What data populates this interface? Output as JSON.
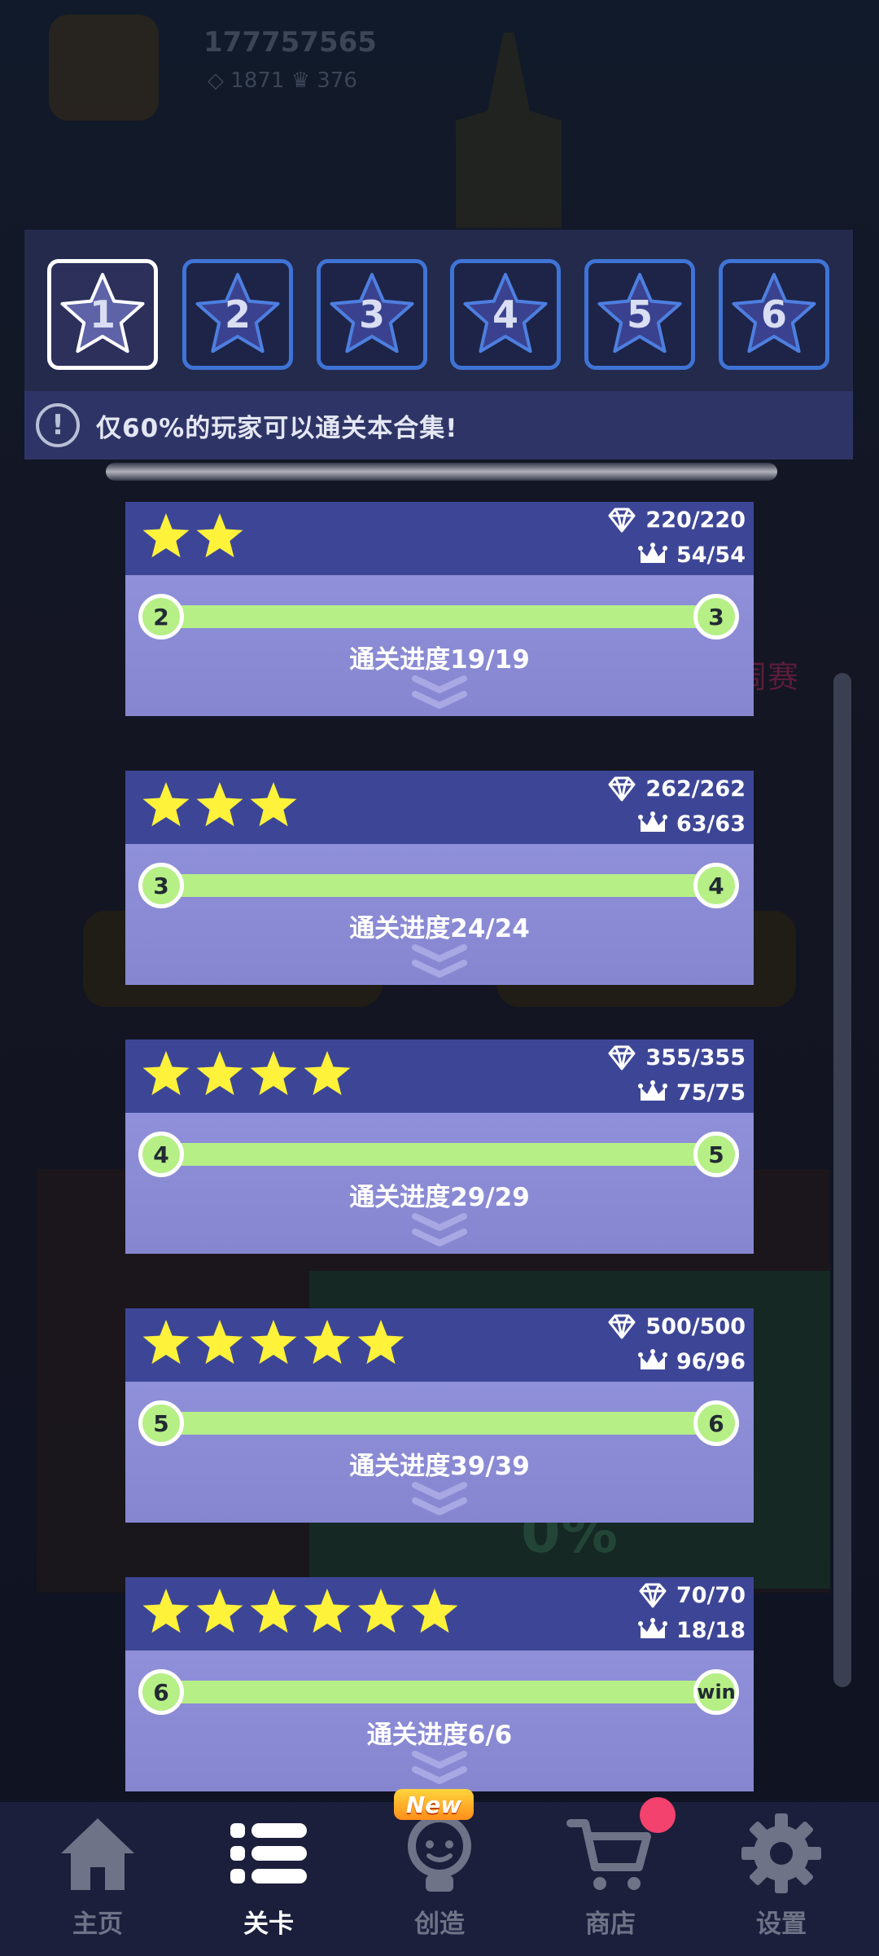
{
  "background": {
    "player_id": "177757565",
    "diamonds": "1871",
    "crowns": "376",
    "right_label": "周赛",
    "percent_label": "0%"
  },
  "tabs": [
    {
      "num": "1",
      "active": true
    },
    {
      "num": "2",
      "active": false
    },
    {
      "num": "3",
      "active": false
    },
    {
      "num": "4",
      "active": false
    },
    {
      "num": "5",
      "active": false
    },
    {
      "num": "6",
      "active": false
    }
  ],
  "notice": {
    "icon": "!",
    "text": "仅60%的玩家可以通关本合集!"
  },
  "chapters": [
    {
      "stars": 2,
      "diamonds": "220/220",
      "crowns": "54/54",
      "start": "2",
      "end": "3",
      "progress": "通关进度19/19"
    },
    {
      "stars": 3,
      "diamonds": "262/262",
      "crowns": "63/63",
      "start": "3",
      "end": "4",
      "progress": "通关进度24/24"
    },
    {
      "stars": 4,
      "diamonds": "355/355",
      "crowns": "75/75",
      "start": "4",
      "end": "5",
      "progress": "通关进度29/29"
    },
    {
      "stars": 5,
      "diamonds": "500/500",
      "crowns": "96/96",
      "start": "5",
      "end": "6",
      "progress": "通关进度39/39"
    },
    {
      "stars": 6,
      "diamonds": "70/70",
      "crowns": "18/18",
      "start": "6",
      "end": "win",
      "progress": "通关进度6/6"
    }
  ],
  "nav": [
    {
      "label": "主页",
      "icon": "home-icon",
      "active": false
    },
    {
      "label": "关卡",
      "icon": "list-icon",
      "active": true
    },
    {
      "label": "创造",
      "icon": "bulb-icon",
      "active": false,
      "badge": "New"
    },
    {
      "label": "商店",
      "icon": "cart-icon",
      "active": false
    },
    {
      "label": "设置",
      "icon": "gear-icon",
      "active": false
    }
  ],
  "colors": {
    "accent_tab_border": "#3f74d6",
    "card_header": "#3d4696",
    "card_body": "#8f90d9",
    "progress_green": "#b6ef86",
    "star_yellow": "#fff23a",
    "notification_red": "#f2426d"
  }
}
